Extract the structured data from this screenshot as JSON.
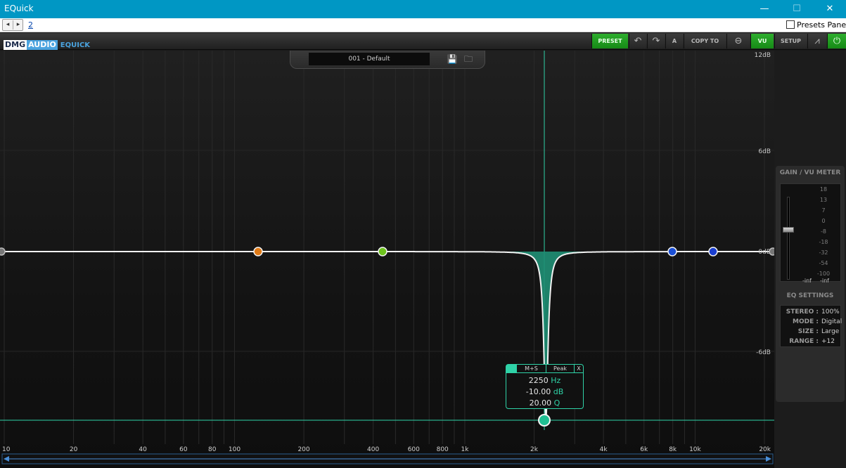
{
  "window": {
    "title": "EQuick",
    "minimize_glyph": "—",
    "maximize_glyph": "☐",
    "close_glyph": "✕"
  },
  "host_toolbar": {
    "prev_glyph": "◂",
    "next_glyph": "▸",
    "page_link": "2",
    "presets_pane_label": "Presets Pane",
    "presets_pane_checked": false
  },
  "plugin_header": {
    "logo_dmg": "DMG",
    "logo_audio": "AUDIO",
    "product": "EQUICK",
    "buttons": {
      "preset": "PRESET",
      "undo": "↶",
      "redo": "↷",
      "ab": "A",
      "copy_to": "COPY TO",
      "link": "⊖",
      "vu": "VU",
      "setup": "SETUP",
      "analyzer": "⩘",
      "power": "⏻"
    }
  },
  "preset_bar": {
    "name": "001 - Default",
    "save_icon": "💾",
    "folder_icon": "🗀"
  },
  "eq": {
    "db_labels": [
      "12dB",
      "6dB",
      "0dB",
      "-6dB"
    ],
    "freq_labels": [
      "10",
      "20",
      "40",
      "60",
      "80",
      "100",
      "200",
      "400",
      "600",
      "800",
      "1k",
      "2k",
      "4k",
      "6k",
      "8k",
      "10k",
      "20k"
    ],
    "accent_color": "#2fd2a7",
    "selected_band": {
      "mode": "M+S",
      "type": "Peak",
      "close": "X",
      "freq": "2250",
      "freq_unit": "Hz",
      "gain": "-10.00",
      "gain_unit": "dB",
      "q": "20.00",
      "q_unit": "Q"
    }
  },
  "side_panel": {
    "gain_title": "GAIN / VU METER",
    "vu_scale": [
      "18",
      "13",
      "7",
      "0",
      "-8",
      "-18",
      "-32",
      "-54",
      "-100"
    ],
    "vu_left": "-inf",
    "vu_right": "-inf",
    "eq_settings_title": "EQ SETTINGS",
    "settings": [
      {
        "key": "STEREO :",
        "value": "100%"
      },
      {
        "key": "MODE :",
        "value": "Digital"
      },
      {
        "key": "SIZE :",
        "value": "Large"
      },
      {
        "key": "RANGE :",
        "value": "+12"
      }
    ]
  }
}
